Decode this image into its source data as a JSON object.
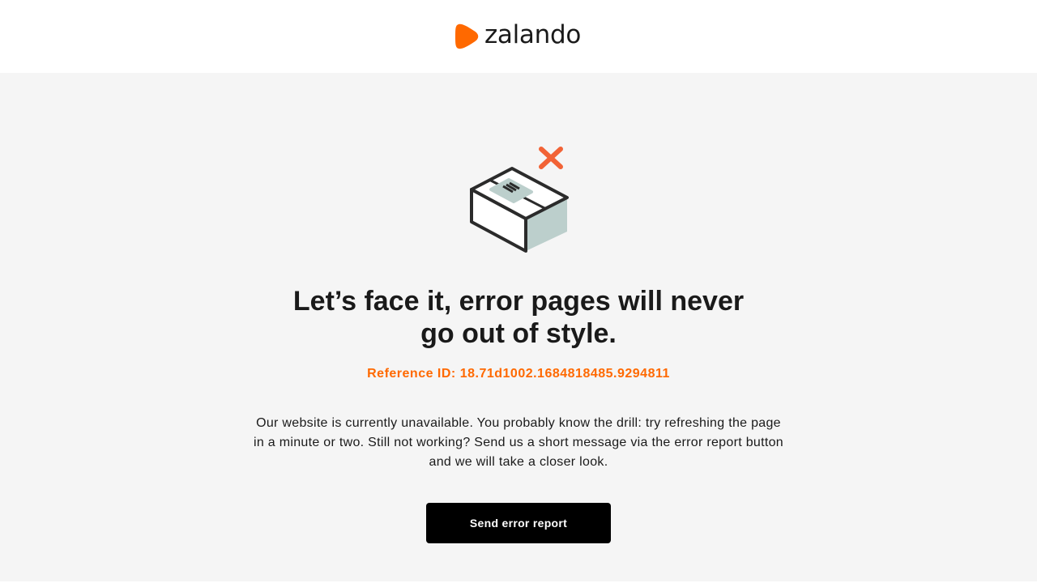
{
  "header": {
    "brand_name": "zalando",
    "brand_color": "#ff6900"
  },
  "illustration": {
    "icon": "damaged-package-icon",
    "error_mark_icon": "close-x-icon",
    "error_mark_color": "#f26336"
  },
  "error": {
    "headline": "Let’s face it, error pages will never go out of style.",
    "reference": "Reference ID: 18.71d1002.1684818485.9294811",
    "message": "Our website is currently unavailable. You probably know the drill: try refreshing the page in a minute or two. Still not working? Send us a short message via the error report button and we will take a closer look.",
    "button_label": "Send error report"
  }
}
